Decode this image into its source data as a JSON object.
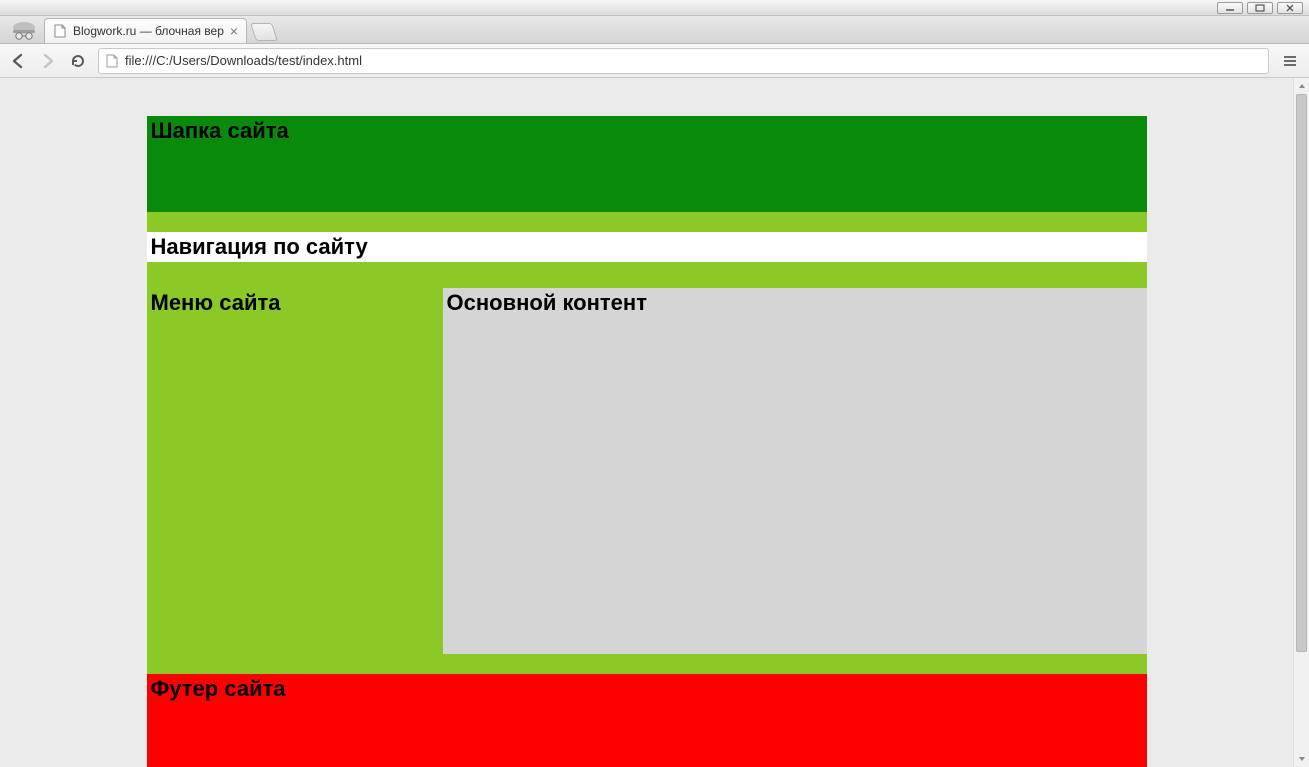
{
  "browser": {
    "tab_title": "Blogwork.ru — блочная вер",
    "url": "file:///C:/Users/Downloads/test/index.html"
  },
  "page": {
    "header_label": "Шапка сайта",
    "nav_label": "Навигация по сайту",
    "menu_label": "Меню сайта",
    "content_label": "Основной контент",
    "footer_label": "Футер сайта"
  }
}
